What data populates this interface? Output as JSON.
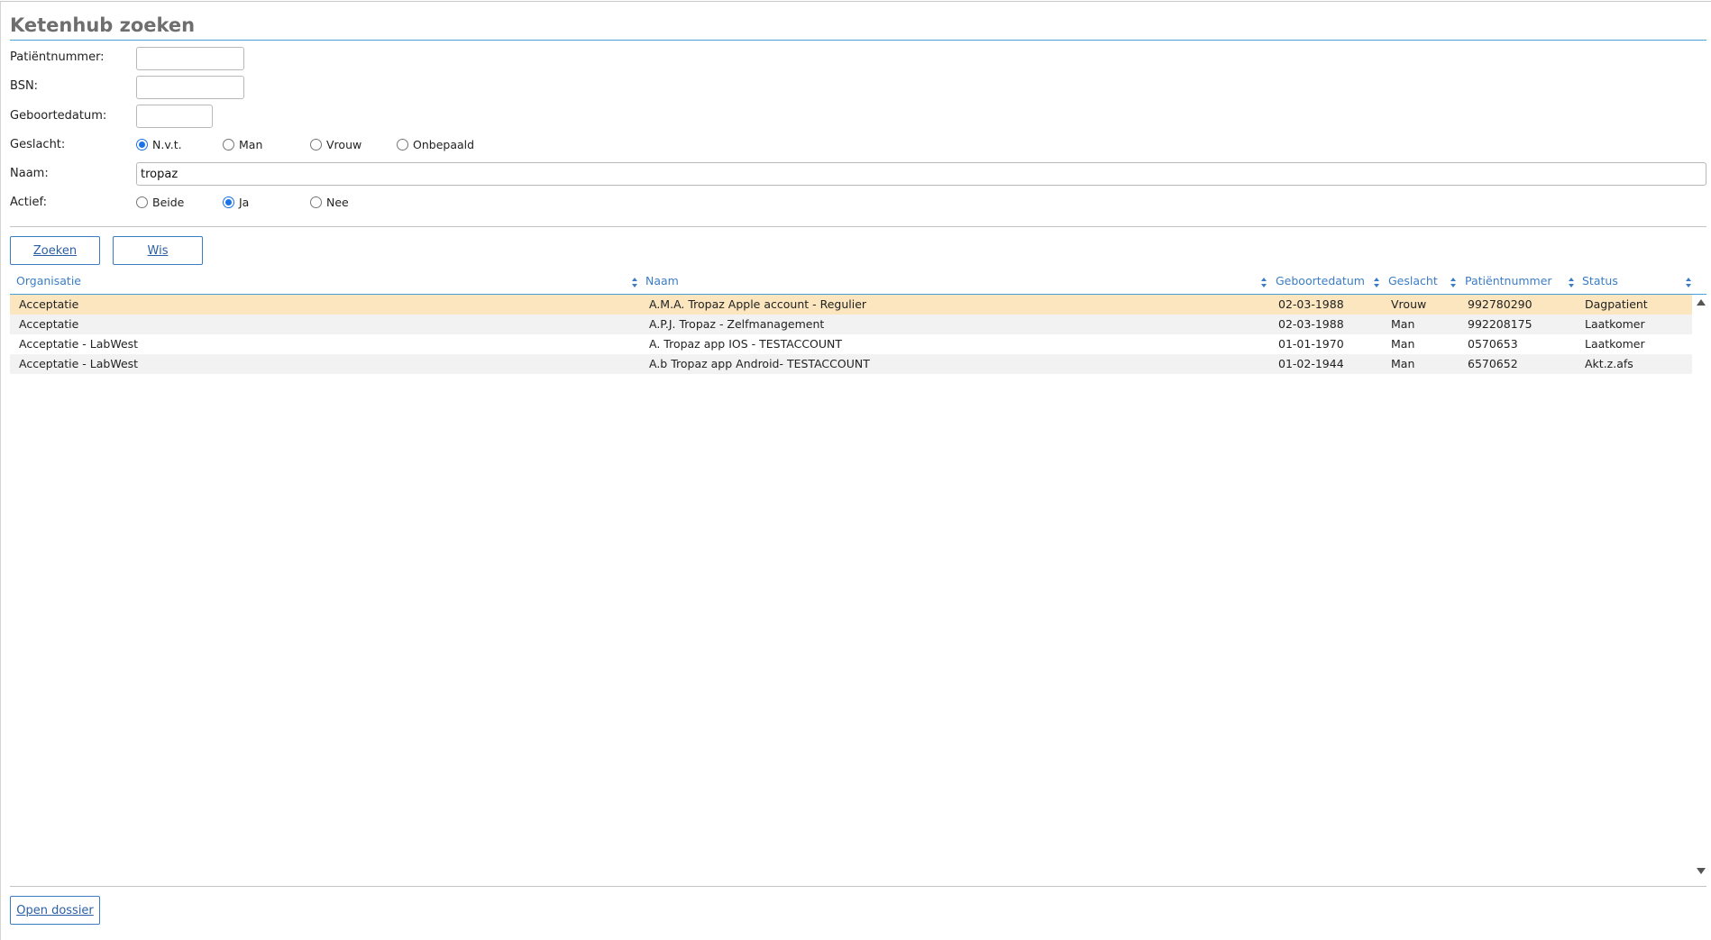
{
  "page": {
    "title": "Ketenhub zoeken"
  },
  "form": {
    "patientnummer": {
      "label": "Patiëntnummer:",
      "value": ""
    },
    "bsn": {
      "label": "BSN:",
      "value": ""
    },
    "geboortedatum": {
      "label": "Geboortedatum:",
      "value": ""
    },
    "geslacht": {
      "label": "Geslacht:",
      "options": [
        "N.v.t.",
        "Man",
        "Vrouw",
        "Onbepaald"
      ],
      "selected": "N.v.t."
    },
    "naam": {
      "label": "Naam:",
      "value": "tropaz"
    },
    "actief": {
      "label": "Actief:",
      "options": [
        "Beide",
        "Ja",
        "Nee"
      ],
      "selected": "Ja"
    }
  },
  "buttons": {
    "zoeken": "Zoeken",
    "wis": "Wis",
    "open_dossier": "Open dossier"
  },
  "table": {
    "columns": [
      "Organisatie",
      "Naam",
      "Geboortedatum",
      "Geslacht",
      "Patiëntnummer",
      "Status"
    ],
    "rows": [
      [
        "Acceptatie",
        "A.M.A. Tropaz Apple account - Regulier",
        "02-03-1988",
        "Vrouw",
        "992780290",
        "Dagpatient"
      ],
      [
        "Acceptatie",
        "A.P.J. Tropaz - Zelfmanagement",
        "02-03-1988",
        "Man",
        "992208175",
        "Laatkomer"
      ],
      [
        "Acceptatie - LabWest",
        "A. Tropaz app IOS - TESTACCOUNT",
        "01-01-1970",
        "Man",
        "0570653",
        "Laatkomer"
      ],
      [
        "Acceptatie - LabWest",
        "A.b Tropaz app Android- TESTACCOUNT",
        "01-02-1944",
        "Man",
        "6570652",
        "Akt.z.afs"
      ]
    ],
    "selected_row": 0
  },
  "icons": {
    "sort": "sort-icon",
    "scroll_up": "scroll-up-icon",
    "scroll_down": "scroll-down-icon"
  }
}
